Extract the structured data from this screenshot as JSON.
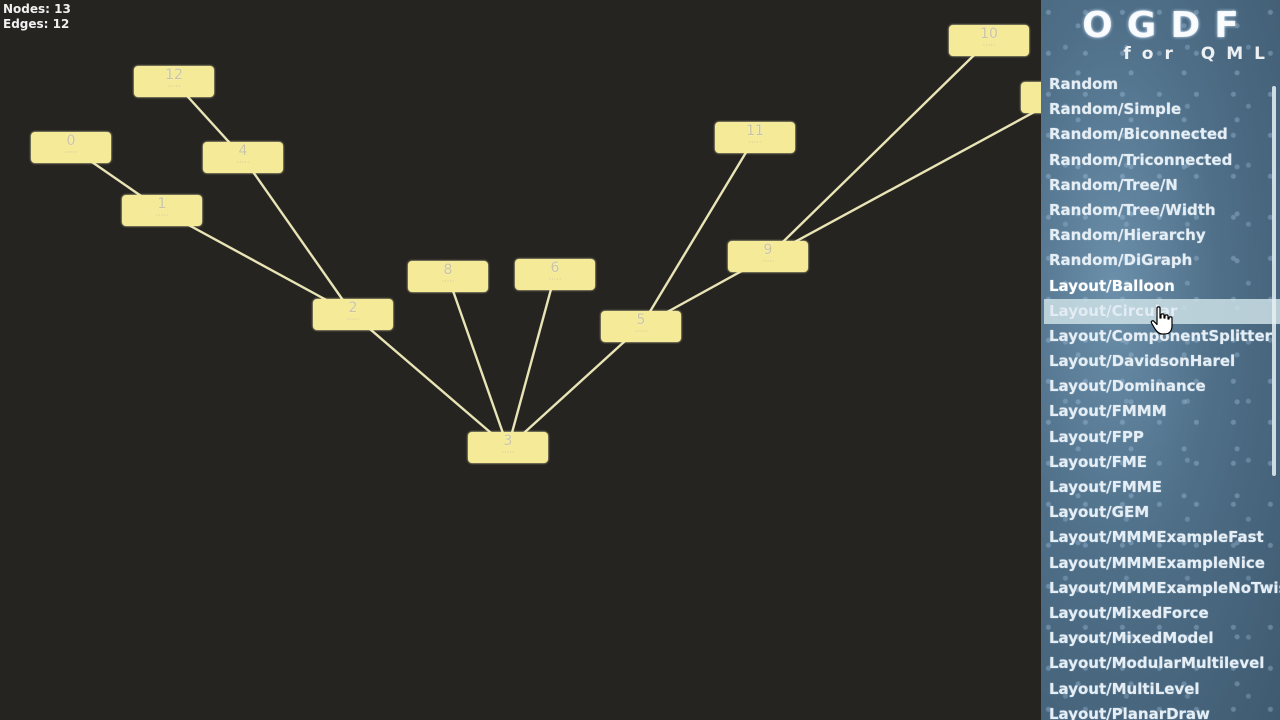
{
  "stats": {
    "nodes": "Nodes: 13",
    "edges": "Edges: 12"
  },
  "logo": {
    "title": "OGDF",
    "subtitle": "for QML"
  },
  "graph": {
    "nodes": [
      {
        "id": "0",
        "label": "0"
      },
      {
        "id": "1",
        "label": "1"
      },
      {
        "id": "2",
        "label": "2"
      },
      {
        "id": "3",
        "label": "3"
      },
      {
        "id": "4",
        "label": "4"
      },
      {
        "id": "5",
        "label": "5"
      },
      {
        "id": "6",
        "label": "6"
      },
      {
        "id": "8",
        "label": "8"
      },
      {
        "id": "9",
        "label": "9"
      },
      {
        "id": "10",
        "label": "10"
      },
      {
        "id": "11",
        "label": "11"
      },
      {
        "id": "12",
        "label": "12"
      },
      {
        "id": "n13",
        "label": ""
      }
    ],
    "edges": [
      [
        "0",
        "1"
      ],
      [
        "1",
        "2"
      ],
      [
        "12",
        "4"
      ],
      [
        "4",
        "2"
      ],
      [
        "2",
        "3"
      ],
      [
        "8",
        "3"
      ],
      [
        "6",
        "3"
      ],
      [
        "3",
        "5"
      ],
      [
        "5",
        "11"
      ],
      [
        "5",
        "9"
      ],
      [
        "9",
        "10"
      ],
      [
        "9",
        "n13"
      ]
    ]
  },
  "menu": {
    "items": [
      "Random",
      "Random/Simple",
      "Random/Biconnected",
      "Random/Triconnected",
      "Random/Tree/N",
      "Random/Tree/Width",
      "Random/Hierarchy",
      "Random/DiGraph",
      "Layout/Balloon",
      "Layout/Circular",
      "Layout/ComponentSplitter",
      "Layout/DavidsonHarel",
      "Layout/Dominance",
      "Layout/FMMM",
      "Layout/FPP",
      "Layout/FME",
      "Layout/FMME",
      "Layout/GEM",
      "Layout/MMMExampleFast",
      "Layout/MMMExampleNice",
      "Layout/MMMExampleNoTwist",
      "Layout/MixedForce",
      "Layout/MixedModel",
      "Layout/ModularMultilevel",
      "Layout/MultiLevel",
      "Layout/PlanarDraw"
    ],
    "current_index": 8,
    "highlight_index": 9
  }
}
